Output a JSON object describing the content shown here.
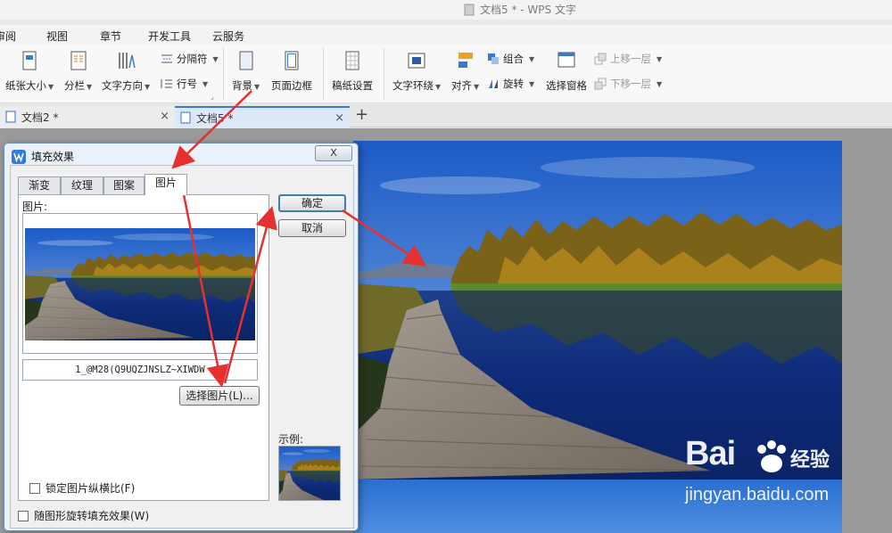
{
  "app": {
    "window_title": "文档5 * - WPS 文字"
  },
  "menu": {
    "items": [
      "审阅",
      "视图",
      "章节",
      "开发工具",
      "云服务"
    ]
  },
  "ribbon": {
    "paper_size": "纸张大小",
    "columns": "分栏",
    "text_direction": "文字方向",
    "separator": "分隔符",
    "line_number": "行号",
    "background": "背景",
    "page_border": "页面边框",
    "draft_settings": "稿纸设置",
    "text_wrap": "文字环绕",
    "align": "对齐",
    "group": "组合",
    "rotate": "旋转",
    "selection_pane": "选择窗格",
    "bring_forward": "上移一层",
    "send_backward": "下移一层"
  },
  "tabs": [
    {
      "label": "文档2 *"
    },
    {
      "label": "文档5 *"
    }
  ],
  "new_tab_symbol": "+",
  "close_symbol": "×",
  "dialog": {
    "title": "填充效果",
    "close_label": "X",
    "tabs": [
      "渐变",
      "纹理",
      "图案",
      "图片"
    ],
    "active_tab": "图片",
    "picture_label": "图片:",
    "file_name": "1_@M28(Q9UQZJNSLZ~XIWDW",
    "choose_picture": "选择图片(L)...",
    "lock_aspect": "锁定图片纵横比(F)",
    "rotate_with_shape": "随图形旋转填充效果(W)",
    "ok": "确定",
    "cancel": "取消",
    "sample_label": "示例:"
  },
  "watermark": {
    "brand": "Bai",
    "brand_cn": "经验",
    "url": "jingyan.baidu.com"
  },
  "colors": {
    "sky": "#1f64c8",
    "water": "#0d2f8a",
    "arrow": "#e53030"
  }
}
